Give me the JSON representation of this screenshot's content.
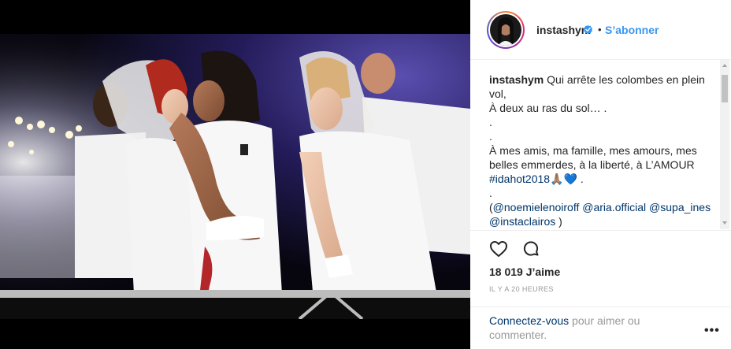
{
  "profile": {
    "username": "instashym",
    "separator": "•",
    "follow_label": "S’abonner"
  },
  "caption": {
    "username": "instashym",
    "line1": "Qui arrête les colombes en plein vol,",
    "line2": "À deux au ras du sol… .",
    "line3": ".",
    "line4": ".",
    "line5": "À mes amis, ma famille, mes amours, mes belles emmerdes, à la liberté, à L’AMOUR",
    "hashtag": "#idahot2018",
    "emoji_tail": "🙏🏽💙 .",
    "line7": ".",
    "mentions_prefix": "(",
    "mention1": "@noemielenoiroff",
    "mention2": "@aria.official",
    "mention3": "@supa_ines",
    "mention4": "@instaclairos",
    "mentions_suffix": ")"
  },
  "stats": {
    "likes": "18 019 J’aime",
    "time": "IL Y A 20 HEURES"
  },
  "login_prompt": {
    "link": "Connectez-vous",
    "rest": " pour aimer ou commenter."
  },
  "more_label": "•••",
  "icons": {
    "verified": "verified-badge-icon",
    "like": "heart-icon",
    "comment": "comment-bubble-icon",
    "more": "more-options-icon"
  },
  "colors": {
    "link_blue": "#3897f0",
    "mention_navy": "#003569",
    "muted": "#999999"
  }
}
